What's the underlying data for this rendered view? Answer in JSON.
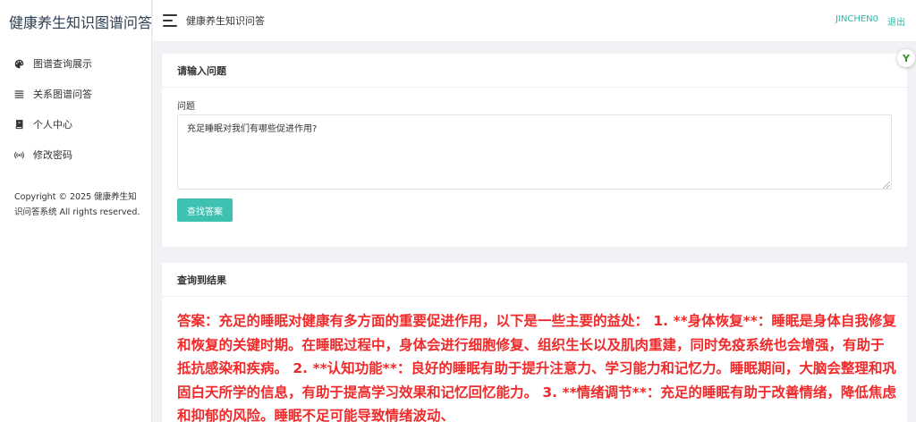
{
  "app": {
    "title": "健康养生知识图谱问答"
  },
  "sidebar": {
    "items": [
      {
        "label": "图谱查询展示",
        "icon": "palette-icon"
      },
      {
        "label": "关系图谱问答",
        "icon": "list-icon"
      },
      {
        "label": "个人中心",
        "icon": "book-icon"
      },
      {
        "label": "修改密码",
        "icon": "broadcast-icon"
      }
    ],
    "copyright": "Copyright © 2025 健康养生知识问答系统 All rights reserved."
  },
  "topbar": {
    "title": "健康养生知识问答",
    "username": "JINCHEN0",
    "logout": "退出"
  },
  "question_panel": {
    "header": "请输入问题",
    "field_label": "问题",
    "question_value": "充足睡眠对我们有哪些促进作用?",
    "search_button": "查找答案"
  },
  "result_panel": {
    "header": "查询到结果",
    "answer": "答案：充足的睡眠对健康有多方面的重要促进作用，以下是一些主要的益处： 1. **身体恢复**：睡眠是身体自我修复和恢复的关键时期。在睡眠过程中，身体会进行细胞修复、组织生长以及肌肉重建，同时免疫系统也会增强，有助于抵抗感染和疾病。 2. **认知功能**：良好的睡眠有助于提升注意力、学习能力和记忆力。睡眠期间，大脑会整理和巩固白天所学的信息，有助于提高学习效果和记忆回忆能力。 3. **情绪调节**：充足的睡眠有助于改善情绪，降低焦虑和抑郁的风险。睡眠不足可能导致情绪波动、"
  },
  "extension": {
    "glyph": "Y"
  },
  "colors": {
    "accent": "#3fc1b1",
    "answer_text": "#f02a2a",
    "link": "#2fb7a8"
  }
}
